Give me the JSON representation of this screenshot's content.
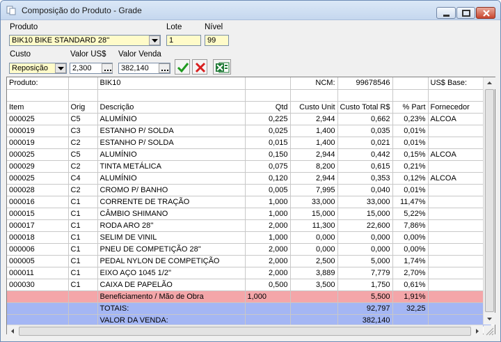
{
  "window": {
    "title": "Composição do Produto - Grade"
  },
  "form": {
    "produto_label": "Produto",
    "produto_value": "BIK10  BIKE STANDARD 28''",
    "lote_label": "Lote",
    "lote_value": "1",
    "nivel_label": "Nível",
    "nivel_value": "99",
    "custo_label": "Custo",
    "custo_value": "Reposição",
    "valor_us_label": "Valor US$",
    "valor_us_value": "2,300",
    "valor_venda_label": "Valor Venda",
    "valor_venda_value": "382,140"
  },
  "toolbar": {
    "confirm_icon": "check-icon",
    "cancel_icon": "x-icon",
    "excel_icon": "excel-icon"
  },
  "grid": {
    "info": {
      "produto_label": "Produto:",
      "produto_value": "BIK10",
      "ncm_label": "NCM:",
      "ncm_value": "99678546",
      "us_base_label": "US$ Base:"
    },
    "headers": [
      "Item",
      "Orig",
      "Descrição",
      "Qtd",
      "Custo Unit",
      "Custo Total R$",
      "% Part",
      "Fornecedor"
    ],
    "rows": [
      [
        "000025",
        "C5",
        "ALUMÍNIO",
        "0,225",
        "2,944",
        "0,662",
        "0,23%",
        "ALCOA"
      ],
      [
        "000019",
        "C3",
        "ESTANHO P/ SOLDA",
        "0,025",
        "1,400",
        "0,035",
        "0,01%",
        ""
      ],
      [
        "000019",
        "C2",
        "ESTANHO P/ SOLDA",
        "0,015",
        "1,400",
        "0,021",
        "0,01%",
        ""
      ],
      [
        "000025",
        "C5",
        "ALUMÍNIO",
        "0,150",
        "2,944",
        "0,442",
        "0,15%",
        "ALCOA"
      ],
      [
        "000029",
        "C2",
        "TINTA METÁLICA",
        "0,075",
        "8,200",
        "0,615",
        "0,21%",
        ""
      ],
      [
        "000025",
        "C4",
        "ALUMÍNIO",
        "0,120",
        "2,944",
        "0,353",
        "0,12%",
        "ALCOA"
      ],
      [
        "000028",
        "C2",
        "CROMO P/ BANHO",
        "0,005",
        "7,995",
        "0,040",
        "0,01%",
        ""
      ],
      [
        "000016",
        "C1",
        "CORRENTE DE TRAÇÃO",
        "1,000",
        "33,000",
        "33,000",
        "11,47%",
        ""
      ],
      [
        "000015",
        "C1",
        "CÂMBIO SHIMANO",
        "1,000",
        "15,000",
        "15,000",
        "5,22%",
        ""
      ],
      [
        "000017",
        "C1",
        "RODA ARO 28''",
        "2,000",
        "11,300",
        "22,600",
        "7,86%",
        ""
      ],
      [
        "000018",
        "C1",
        "SELIM DE VINIL",
        "1,000",
        "0,000",
        "0,000",
        "0,00%",
        ""
      ],
      [
        "000006",
        "C1",
        "PNEU DE COMPETIÇÃO 28''",
        "2,000",
        "0,000",
        "0,000",
        "0,00%",
        ""
      ],
      [
        "000005",
        "C1",
        "PEDAL NYLON DE COMPETIÇÃO",
        "2,000",
        "2,500",
        "5,000",
        "1,74%",
        ""
      ],
      [
        "000011",
        "C1",
        "EIXO AÇO 1045 1/2''",
        "2,000",
        "3,889",
        "7,779",
        "2,70%",
        ""
      ],
      [
        "000030",
        "C1",
        "CAIXA DE PAPELÃO",
        "0,500",
        "3,500",
        "1,750",
        "0,61%",
        ""
      ]
    ],
    "beneficiamento": {
      "label": "Beneficiamento / Mão de Obra",
      "qtd": "1,000",
      "custo_total": "5,500",
      "part": "1,91%"
    },
    "totais": {
      "label": "TOTAIS:",
      "custo_total": "92,797",
      "part": "32,25"
    },
    "valor_venda": {
      "label": "VALOR DA VENDA:",
      "custo_total": "382,140"
    }
  },
  "colors": {
    "pink_row": "#f4a6a9",
    "blue_row": "#a4b6f4",
    "input_bg": "#fffbc9"
  }
}
